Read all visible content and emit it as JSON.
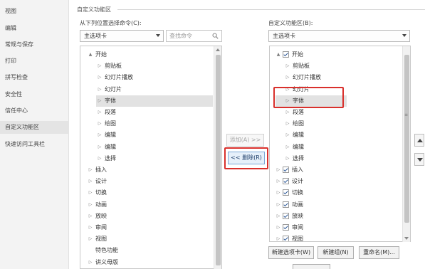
{
  "nav": {
    "items": [
      {
        "label": "视图"
      },
      {
        "label": "编辑"
      },
      {
        "label": "常规与保存"
      },
      {
        "label": "打印"
      },
      {
        "label": "拼写检查"
      },
      {
        "label": "安全性"
      },
      {
        "label": "信任中心"
      },
      {
        "label": "自定义功能区",
        "active": true
      },
      {
        "label": "快速访问工具栏"
      }
    ]
  },
  "section": {
    "title": "自定义功能区"
  },
  "left": {
    "label": "从下列位置选择命令(C):",
    "dropdown": "主选项卡",
    "search_placeholder": "查找命令",
    "rows": [
      {
        "label": "开始",
        "twisty": "▲",
        "level": 0
      },
      {
        "label": "剪贴板",
        "twisty": "▷",
        "level": 1
      },
      {
        "label": "幻灯片播放",
        "twisty": "▷",
        "level": 1
      },
      {
        "label": "幻灯片",
        "twisty": "▷",
        "level": 1
      },
      {
        "label": "字体",
        "twisty": "▷",
        "level": 1,
        "selected": true
      },
      {
        "label": "段落",
        "twisty": "▷",
        "level": 1
      },
      {
        "label": "绘图",
        "twisty": "▷",
        "level": 1
      },
      {
        "label": "编辑",
        "twisty": "▷",
        "level": 1
      },
      {
        "label": "编辑",
        "twisty": "▷",
        "level": 1
      },
      {
        "label": "选择",
        "twisty": "▷",
        "level": 1
      },
      {
        "label": "插入",
        "twisty": "▷",
        "level": 0
      },
      {
        "label": "设计",
        "twisty": "▷",
        "level": 0
      },
      {
        "label": "切换",
        "twisty": "▷",
        "level": 0
      },
      {
        "label": "动画",
        "twisty": "▷",
        "level": 0
      },
      {
        "label": "放映",
        "twisty": "▷",
        "level": 0
      },
      {
        "label": "审阅",
        "twisty": "▷",
        "level": 0
      },
      {
        "label": "视图",
        "twisty": "▷",
        "level": 0
      },
      {
        "label": "特色功能",
        "twisty": "",
        "level": 0
      },
      {
        "label": "讲义母版",
        "twisty": "▷",
        "level": 0
      }
    ]
  },
  "middle": {
    "add_label": "添加(A) >>",
    "remove_label": "<< 删除(R)"
  },
  "right": {
    "label": "自定义功能区(B):",
    "dropdown": "主选项卡",
    "rows": [
      {
        "label": "开始",
        "twisty": "▲",
        "level": 0,
        "checked": true
      },
      {
        "label": "剪贴板",
        "twisty": "▷",
        "level": 1
      },
      {
        "label": "幻灯片播放",
        "twisty": "▷",
        "level": 1
      },
      {
        "label": "幻灯片",
        "twisty": "▷",
        "level": 1
      },
      {
        "label": "字体",
        "twisty": "▷",
        "level": 1,
        "selected": true
      },
      {
        "label": "段落",
        "twisty": "▷",
        "level": 1
      },
      {
        "label": "绘图",
        "twisty": "▷",
        "level": 1
      },
      {
        "label": "编辑",
        "twisty": "▷",
        "level": 1
      },
      {
        "label": "编辑",
        "twisty": "▷",
        "level": 1
      },
      {
        "label": "选择",
        "twisty": "▷",
        "level": 1
      },
      {
        "label": "插入",
        "twisty": "▷",
        "level": 0,
        "checked": true
      },
      {
        "label": "设计",
        "twisty": "▷",
        "level": 0,
        "checked": true
      },
      {
        "label": "切换",
        "twisty": "▷",
        "level": 0,
        "checked": true
      },
      {
        "label": "动画",
        "twisty": "▷",
        "level": 0,
        "checked": true
      },
      {
        "label": "放映",
        "twisty": "▷",
        "level": 0,
        "checked": true
      },
      {
        "label": "审阅",
        "twisty": "▷",
        "level": 0,
        "checked": true
      },
      {
        "label": "视图",
        "twisty": "▷",
        "level": 0,
        "checked": true
      }
    ],
    "buttons": {
      "new_tab": "新建选项卡(W)",
      "new_group": "新建组(N)",
      "rename": "重命名(M)..."
    }
  },
  "colors": {
    "highlight_red": "#d9302c",
    "selection_gray": "#e2e2e2"
  }
}
